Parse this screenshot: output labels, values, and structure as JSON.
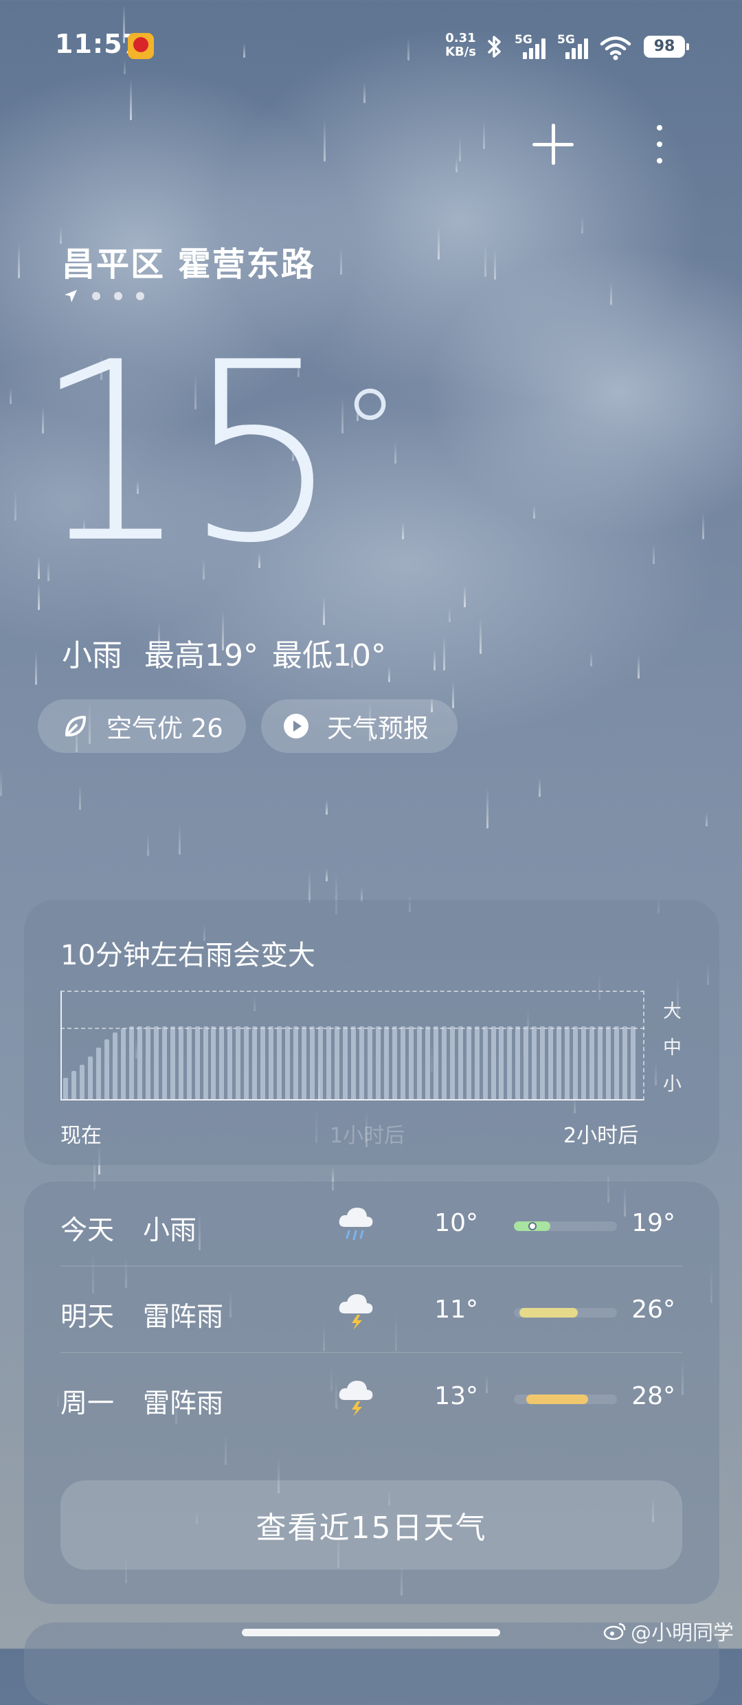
{
  "status_bar": {
    "time": "11:57",
    "net_speed_value": "0.31",
    "net_speed_unit": "KB/s",
    "signal_1_label": "5G",
    "signal_2_label": "5G",
    "battery": "98",
    "icons": [
      "app-badge-icon",
      "bluetooth-icon",
      "signal-icon",
      "signal-icon",
      "wifi-icon",
      "battery-icon"
    ]
  },
  "header": {
    "location": "昌平区 霍营东路",
    "actions": [
      "add-city-icon",
      "more-options-icon"
    ]
  },
  "current": {
    "temperature": "15",
    "degree_symbol": "°",
    "condition": "小雨",
    "high": "最高19°",
    "low": "最低10°"
  },
  "pills": {
    "air_quality": "空气优 26",
    "forecast_video": "天气预报"
  },
  "rain_card": {
    "title": "10分钟左右雨会变大",
    "levels": [
      "大",
      "中",
      "小"
    ],
    "x_axis": [
      "现在",
      "1小时后",
      "2小时后"
    ],
    "chart_data": {
      "type": "bar",
      "title": "10分钟左右雨会变大",
      "x_labels": [
        "现在",
        "1小时后",
        "2小时后"
      ],
      "y_levels": [
        "小",
        "中",
        "大"
      ],
      "ylim": [
        0,
        1
      ],
      "values": [
        0.2,
        0.26,
        0.32,
        0.4,
        0.48,
        0.56,
        0.62,
        0.66,
        0.68,
        0.68,
        0.68,
        0.68,
        0.68,
        0.68,
        0.68,
        0.68,
        0.68,
        0.68,
        0.68,
        0.68,
        0.68,
        0.68,
        0.68,
        0.68,
        0.68,
        0.68,
        0.68,
        0.68,
        0.68,
        0.68,
        0.68,
        0.68,
        0.68,
        0.68,
        0.68,
        0.68,
        0.68,
        0.68,
        0.68,
        0.68,
        0.68,
        0.68,
        0.68,
        0.68,
        0.68,
        0.68,
        0.68,
        0.68,
        0.68,
        0.68,
        0.68,
        0.68,
        0.68,
        0.68,
        0.68,
        0.68,
        0.68,
        0.68,
        0.68,
        0.68,
        0.68,
        0.68,
        0.68,
        0.68,
        0.68,
        0.68,
        0.68,
        0.68,
        0.68,
        0.68
      ]
    }
  },
  "forecast": {
    "days": [
      {
        "day": "今天",
        "condition": "小雨",
        "icon": "rain-cloud-icon",
        "low": "10°",
        "high": "19°",
        "range": [
          0.0,
          0.35
        ],
        "color": "#a8e3a0",
        "current": 0.18
      },
      {
        "day": "明天",
        "condition": "雷阵雨",
        "icon": "thunderstorm-icon",
        "low": "11°",
        "high": "26°",
        "range": [
          0.05,
          0.62
        ],
        "color": "#e6d98a"
      },
      {
        "day": "周一",
        "condition": "雷阵雨",
        "icon": "thunderstorm-icon",
        "low": "13°",
        "high": "28°",
        "range": [
          0.12,
          0.72
        ],
        "color": "#f1c76d"
      }
    ],
    "button_15day": "查看近15日天气"
  },
  "watermark": "@小明同学"
}
